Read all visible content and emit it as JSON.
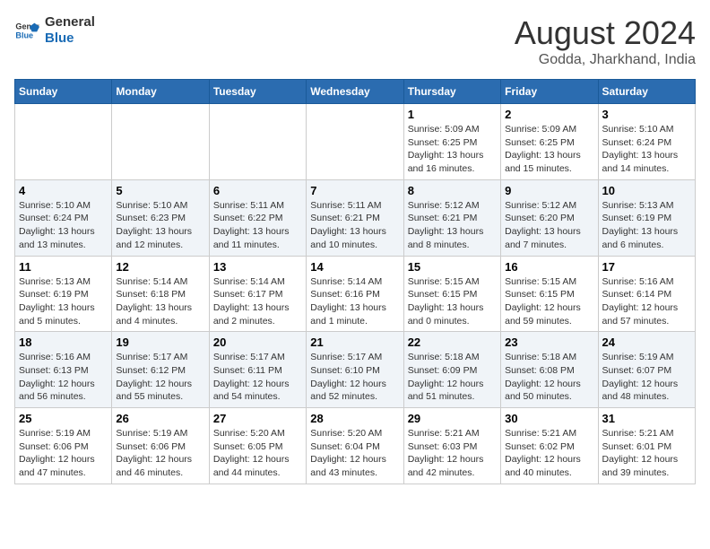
{
  "logo": {
    "text_general": "General",
    "text_blue": "Blue"
  },
  "title": "August 2024",
  "subtitle": "Godda, Jharkhand, India",
  "weekdays": [
    "Sunday",
    "Monday",
    "Tuesday",
    "Wednesday",
    "Thursday",
    "Friday",
    "Saturday"
  ],
  "weeks": [
    [
      {
        "day": "",
        "info": ""
      },
      {
        "day": "",
        "info": ""
      },
      {
        "day": "",
        "info": ""
      },
      {
        "day": "",
        "info": ""
      },
      {
        "day": "1",
        "info": "Sunrise: 5:09 AM\nSunset: 6:25 PM\nDaylight: 13 hours\nand 16 minutes."
      },
      {
        "day": "2",
        "info": "Sunrise: 5:09 AM\nSunset: 6:25 PM\nDaylight: 13 hours\nand 15 minutes."
      },
      {
        "day": "3",
        "info": "Sunrise: 5:10 AM\nSunset: 6:24 PM\nDaylight: 13 hours\nand 14 minutes."
      }
    ],
    [
      {
        "day": "4",
        "info": "Sunrise: 5:10 AM\nSunset: 6:24 PM\nDaylight: 13 hours\nand 13 minutes."
      },
      {
        "day": "5",
        "info": "Sunrise: 5:10 AM\nSunset: 6:23 PM\nDaylight: 13 hours\nand 12 minutes."
      },
      {
        "day": "6",
        "info": "Sunrise: 5:11 AM\nSunset: 6:22 PM\nDaylight: 13 hours\nand 11 minutes."
      },
      {
        "day": "7",
        "info": "Sunrise: 5:11 AM\nSunset: 6:21 PM\nDaylight: 13 hours\nand 10 minutes."
      },
      {
        "day": "8",
        "info": "Sunrise: 5:12 AM\nSunset: 6:21 PM\nDaylight: 13 hours\nand 8 minutes."
      },
      {
        "day": "9",
        "info": "Sunrise: 5:12 AM\nSunset: 6:20 PM\nDaylight: 13 hours\nand 7 minutes."
      },
      {
        "day": "10",
        "info": "Sunrise: 5:13 AM\nSunset: 6:19 PM\nDaylight: 13 hours\nand 6 minutes."
      }
    ],
    [
      {
        "day": "11",
        "info": "Sunrise: 5:13 AM\nSunset: 6:19 PM\nDaylight: 13 hours\nand 5 minutes."
      },
      {
        "day": "12",
        "info": "Sunrise: 5:14 AM\nSunset: 6:18 PM\nDaylight: 13 hours\nand 4 minutes."
      },
      {
        "day": "13",
        "info": "Sunrise: 5:14 AM\nSunset: 6:17 PM\nDaylight: 13 hours\nand 2 minutes."
      },
      {
        "day": "14",
        "info": "Sunrise: 5:14 AM\nSunset: 6:16 PM\nDaylight: 13 hours\nand 1 minute."
      },
      {
        "day": "15",
        "info": "Sunrise: 5:15 AM\nSunset: 6:15 PM\nDaylight: 13 hours\nand 0 minutes."
      },
      {
        "day": "16",
        "info": "Sunrise: 5:15 AM\nSunset: 6:15 PM\nDaylight: 12 hours\nand 59 minutes."
      },
      {
        "day": "17",
        "info": "Sunrise: 5:16 AM\nSunset: 6:14 PM\nDaylight: 12 hours\nand 57 minutes."
      }
    ],
    [
      {
        "day": "18",
        "info": "Sunrise: 5:16 AM\nSunset: 6:13 PM\nDaylight: 12 hours\nand 56 minutes."
      },
      {
        "day": "19",
        "info": "Sunrise: 5:17 AM\nSunset: 6:12 PM\nDaylight: 12 hours\nand 55 minutes."
      },
      {
        "day": "20",
        "info": "Sunrise: 5:17 AM\nSunset: 6:11 PM\nDaylight: 12 hours\nand 54 minutes."
      },
      {
        "day": "21",
        "info": "Sunrise: 5:17 AM\nSunset: 6:10 PM\nDaylight: 12 hours\nand 52 minutes."
      },
      {
        "day": "22",
        "info": "Sunrise: 5:18 AM\nSunset: 6:09 PM\nDaylight: 12 hours\nand 51 minutes."
      },
      {
        "day": "23",
        "info": "Sunrise: 5:18 AM\nSunset: 6:08 PM\nDaylight: 12 hours\nand 50 minutes."
      },
      {
        "day": "24",
        "info": "Sunrise: 5:19 AM\nSunset: 6:07 PM\nDaylight: 12 hours\nand 48 minutes."
      }
    ],
    [
      {
        "day": "25",
        "info": "Sunrise: 5:19 AM\nSunset: 6:06 PM\nDaylight: 12 hours\nand 47 minutes."
      },
      {
        "day": "26",
        "info": "Sunrise: 5:19 AM\nSunset: 6:06 PM\nDaylight: 12 hours\nand 46 minutes."
      },
      {
        "day": "27",
        "info": "Sunrise: 5:20 AM\nSunset: 6:05 PM\nDaylight: 12 hours\nand 44 minutes."
      },
      {
        "day": "28",
        "info": "Sunrise: 5:20 AM\nSunset: 6:04 PM\nDaylight: 12 hours\nand 43 minutes."
      },
      {
        "day": "29",
        "info": "Sunrise: 5:21 AM\nSunset: 6:03 PM\nDaylight: 12 hours\nand 42 minutes."
      },
      {
        "day": "30",
        "info": "Sunrise: 5:21 AM\nSunset: 6:02 PM\nDaylight: 12 hours\nand 40 minutes."
      },
      {
        "day": "31",
        "info": "Sunrise: 5:21 AM\nSunset: 6:01 PM\nDaylight: 12 hours\nand 39 minutes."
      }
    ]
  ]
}
